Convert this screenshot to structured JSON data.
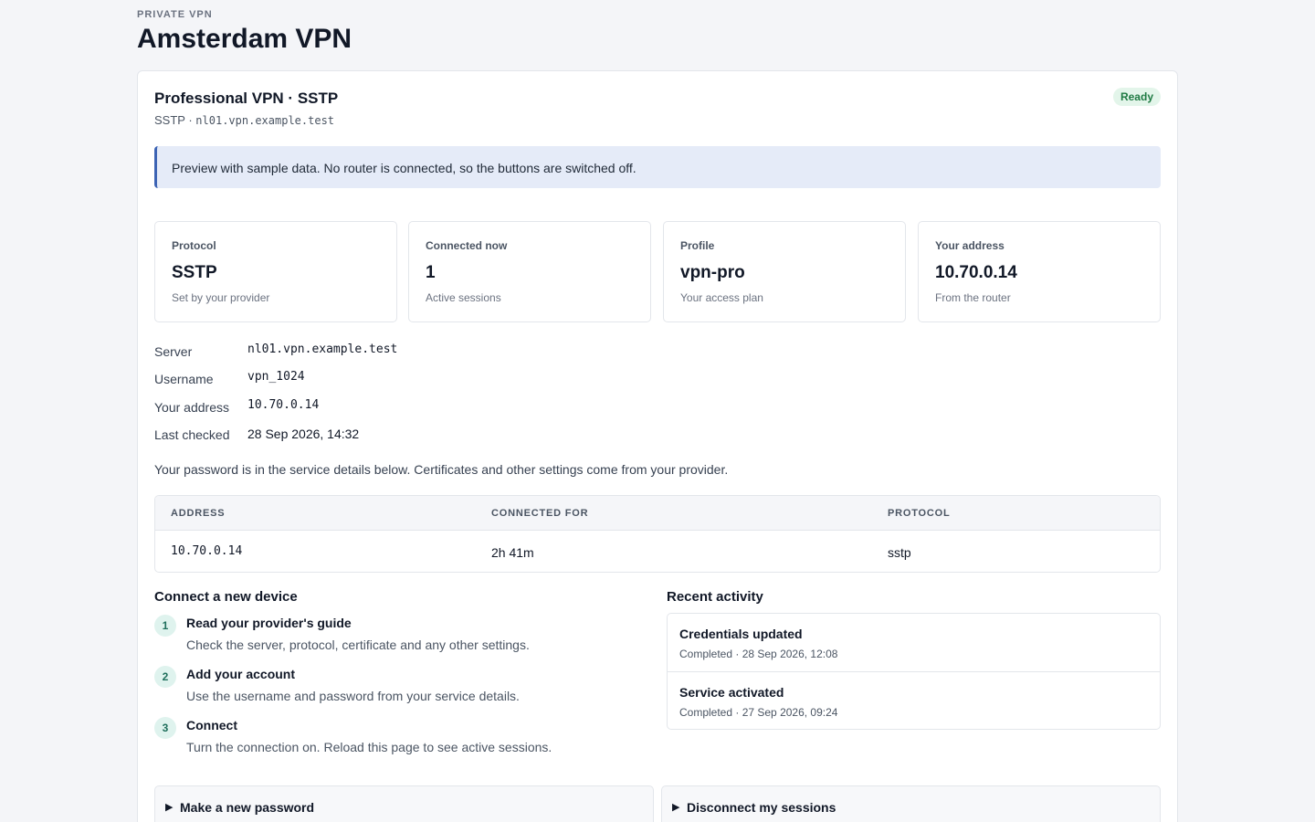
{
  "header": {
    "eyebrow": "PRIVATE VPN",
    "title": "Amsterdam VPN"
  },
  "service": {
    "title": "Professional VPN · SSTP",
    "subtitle_protocol": "SSTP ·",
    "subtitle_host": "nl01.vpn.example.test",
    "status": "Ready"
  },
  "notice": "Preview with sample data. No router is connected, so the buttons are switched off.",
  "stats": [
    {
      "label": "Protocol",
      "value": "SSTP",
      "note": "Set by your provider"
    },
    {
      "label": "Connected now",
      "value": "1",
      "note": "Active sessions"
    },
    {
      "label": "Profile",
      "value": "vpn-pro",
      "note": "Your access plan"
    },
    {
      "label": "Your address",
      "value": "10.70.0.14",
      "note": "From the router"
    }
  ],
  "details": [
    {
      "key": "Server",
      "value": "nl01.vpn.example.test"
    },
    {
      "key": "Username",
      "value": "vpn_1024"
    },
    {
      "key": "Your address",
      "value": "10.70.0.14"
    },
    {
      "key": "Last checked",
      "value": "28 Sep 2026, 14:32"
    }
  ],
  "password_note": "Your password is in the service details below. Certificates and other settings come from your provider.",
  "sessions_table": {
    "columns": [
      "ADDRESS",
      "CONNECTED FOR",
      "PROTOCOL"
    ],
    "rows": [
      [
        "10.70.0.14",
        "2h 41m",
        "sstp"
      ]
    ]
  },
  "connect": {
    "heading": "Connect a new device",
    "steps": [
      {
        "num": "1",
        "title": "Read your provider's guide",
        "desc": "Check the server, protocol, certificate and any other settings."
      },
      {
        "num": "2",
        "title": "Add your account",
        "desc": "Use the username and password from your service details."
      },
      {
        "num": "3",
        "title": "Connect",
        "desc": "Turn the connection on. Reload this page to see active sessions."
      }
    ]
  },
  "activity": {
    "heading": "Recent activity",
    "items": [
      {
        "title": "Credentials updated",
        "meta": "Completed · 28 Sep 2026, 12:08"
      },
      {
        "title": "Service activated",
        "meta": "Completed · 27 Sep 2026, 09:24"
      }
    ]
  },
  "actions": {
    "new_password": "Make a new password",
    "disconnect": "Disconnect my sessions",
    "arrow": "▶"
  }
}
